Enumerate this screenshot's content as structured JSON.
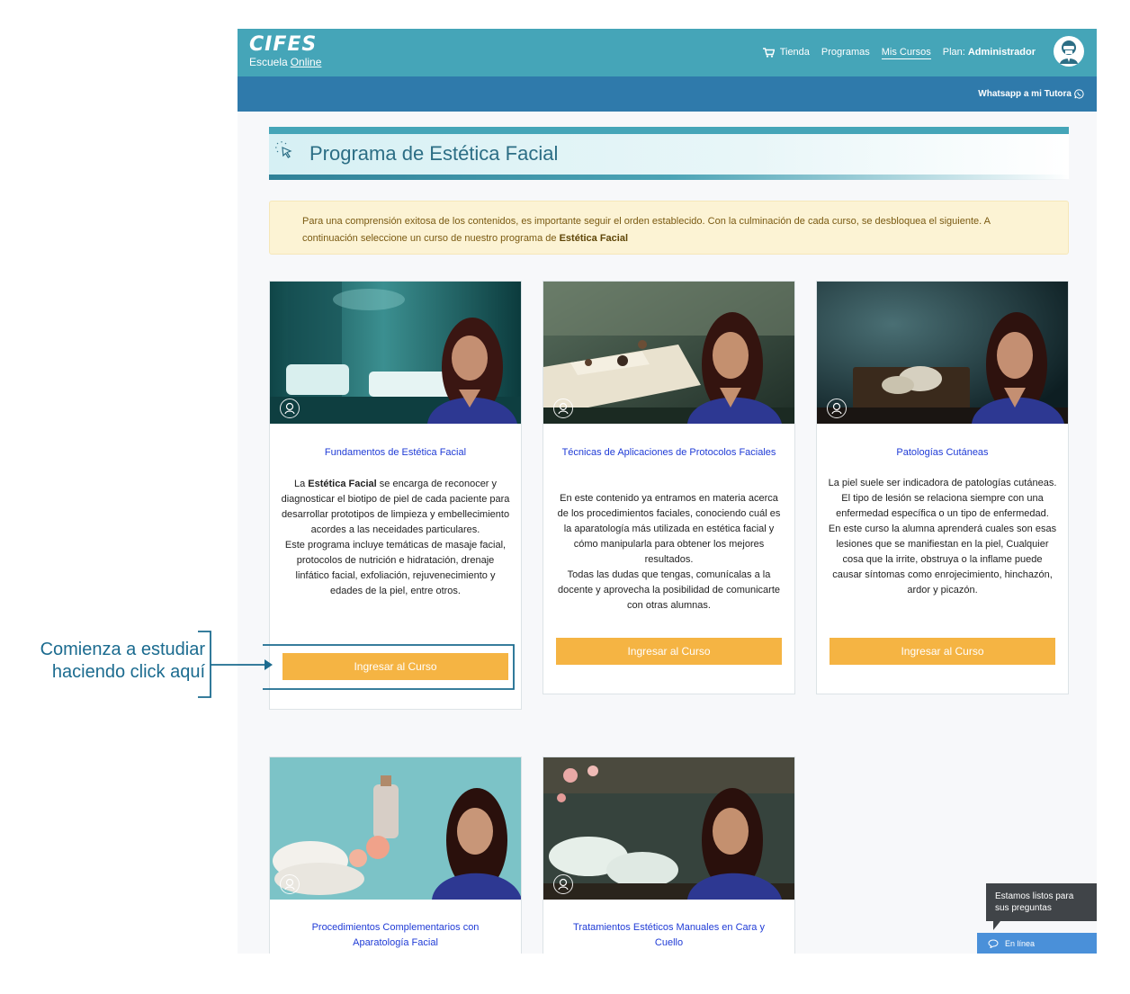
{
  "brand": {
    "logo": "CIFES",
    "sub_prefix": "Escuela",
    "sub_online": "Online"
  },
  "nav": {
    "store": "Tienda",
    "programs": "Programas",
    "my_courses": "Mis Cursos",
    "plan_label": "Plan:",
    "plan_value": "Administrador"
  },
  "subbar": {
    "whatsapp": "Whatsapp a mi Tutora"
  },
  "page": {
    "title": "Programa de Estética Facial",
    "alert_text": "Para una comprensión exitosa de los contenidos, es importante seguir el orden establecido. Con la culminación de cada curso, se desbloquea el siguiente. A continuación seleccione un curso de nuestro programa de",
    "alert_strong": "Estética Facial"
  },
  "courses": [
    {
      "title": "Fundamentos de Estética Facial",
      "desc_strong": "Estética Facial",
      "desc_pre": "La",
      "desc_post": "se encarga de reconocer y diagnosticar el biotipo de piel de cada paciente para desarrollar prototipos de limpieza y embellecimiento acordes a las neceidades particulares.",
      "desc_2": "Este programa incluye temáticas de masaje facial, protocolos de nutrición e hidratación, drenaje linfático facial, exfoliación, rejuvenecimiento y edades de la piel, entre otros.",
      "button": "Ingresar al Curso"
    },
    {
      "title": "Técnicas de Aplicaciones de Protocolos Faciales",
      "desc_1": "En este contenido ya entramos en materia acerca de los procedimientos faciales, conociendo cuál es la aparatología más utilizada en estética facial y cómo manipularla para obtener los mejores resultados.",
      "desc_2": "Todas las dudas que tengas, comunícalas a la docente y aprovecha la posibilidad de comunicarte con otras alumnas.",
      "button": "Ingresar al Curso"
    },
    {
      "title": "Patologías Cutáneas",
      "desc_1": "La piel suele ser indicadora de patologías cutáneas. El tipo de lesión se relaciona siempre con una enfermedad específica o un tipo de enfermedad.",
      "desc_2": "En este curso la alumna aprenderá cuales son esas lesiones que se manifiestan en la piel, Cualquier cosa que la irrite, obstruya o la inflame puede causar síntomas como enrojecimiento, hinchazón, ardor y picazón.",
      "button": "Ingresar al Curso"
    },
    {
      "title": "Procedimientos Complementarios con Aparatología Facial"
    },
    {
      "title": "Tratamientos Estéticos Manuales en Cara y Cuello"
    }
  ],
  "chat": {
    "tip": "Estamos listos para sus preguntas",
    "status": "En línea"
  },
  "annotation": {
    "line1": "Comienza a estudiar",
    "line2": "haciendo click aquí"
  },
  "colors": {
    "topbar": "#45a5b8",
    "subbar": "#2f7aab",
    "button": "#f5b443",
    "link": "#1f3bd6",
    "annotation": "#1b6b8f"
  }
}
